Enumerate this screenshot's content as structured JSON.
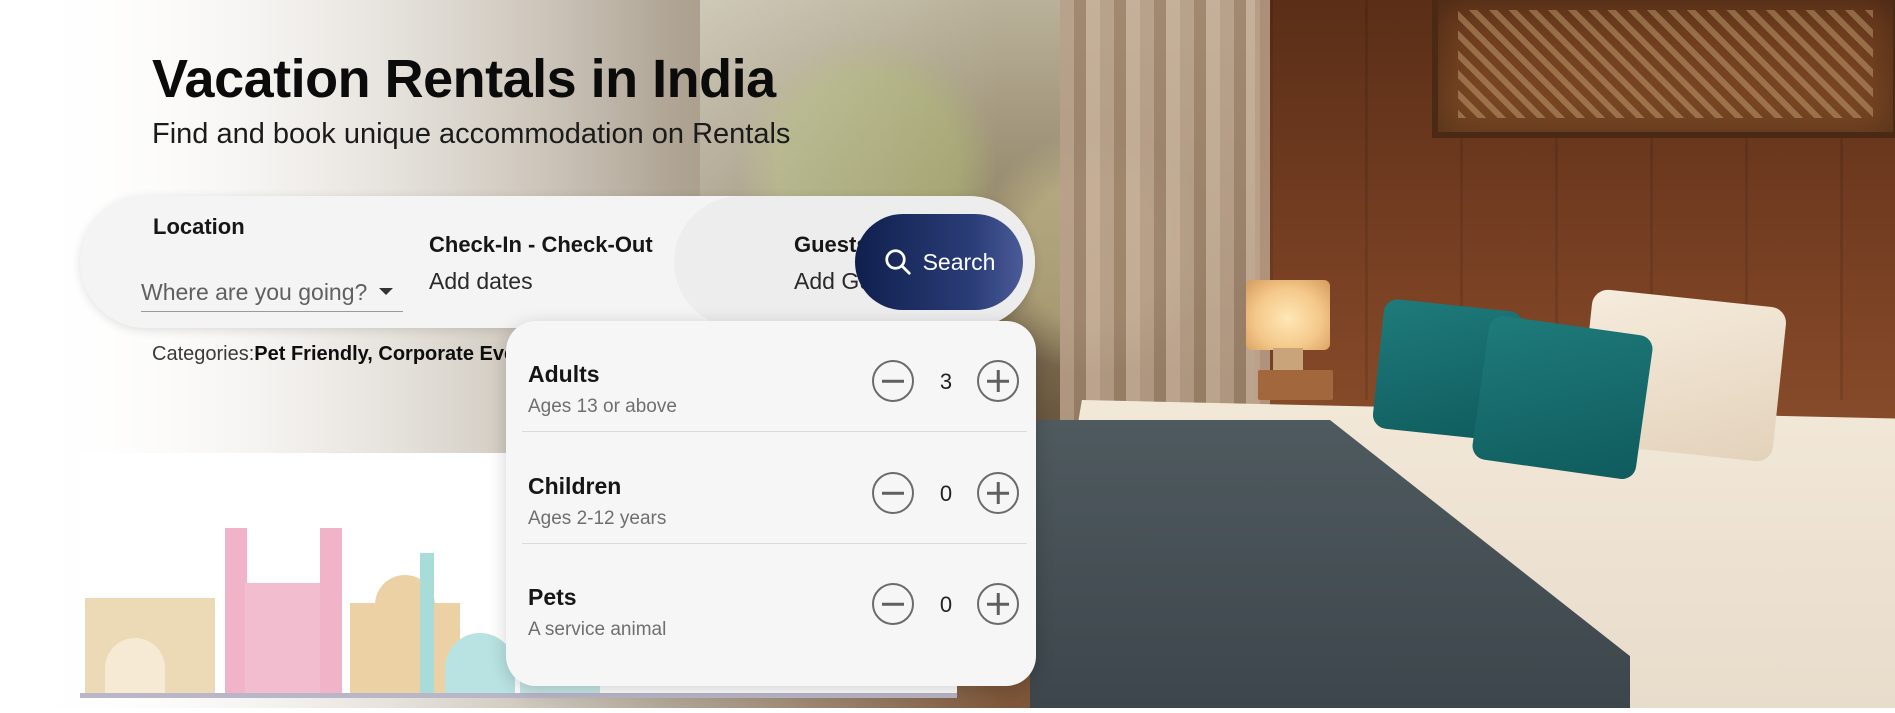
{
  "hero": {
    "title": "Vacation Rentals in India",
    "subtitle": "Find and book unique accommodation on Rentals"
  },
  "search": {
    "location_label": "Location",
    "location_placeholder": "Where are you going?",
    "dates_label": "Check-In - Check-Out",
    "dates_value": "Add dates",
    "guests_label": "Guests",
    "guests_value": "Add Guests",
    "button_label": "Search",
    "button_icon": "search-icon"
  },
  "categories": {
    "label": "Categories:",
    "values": "Pet Friendly, Corporate Eve"
  },
  "guests_popover": {
    "rows": [
      {
        "title": "Adults",
        "subtitle": "Ages 13 or above",
        "count": "3"
      },
      {
        "title": "Children",
        "subtitle": "Ages 2-12 years",
        "count": "0"
      },
      {
        "title": "Pets",
        "subtitle": "A service animal",
        "count": "0"
      }
    ]
  },
  "colors": {
    "search_button_start": "#0f1f4d",
    "search_button_end": "#4a5b97",
    "popover_bg": "#f6f6f6"
  }
}
